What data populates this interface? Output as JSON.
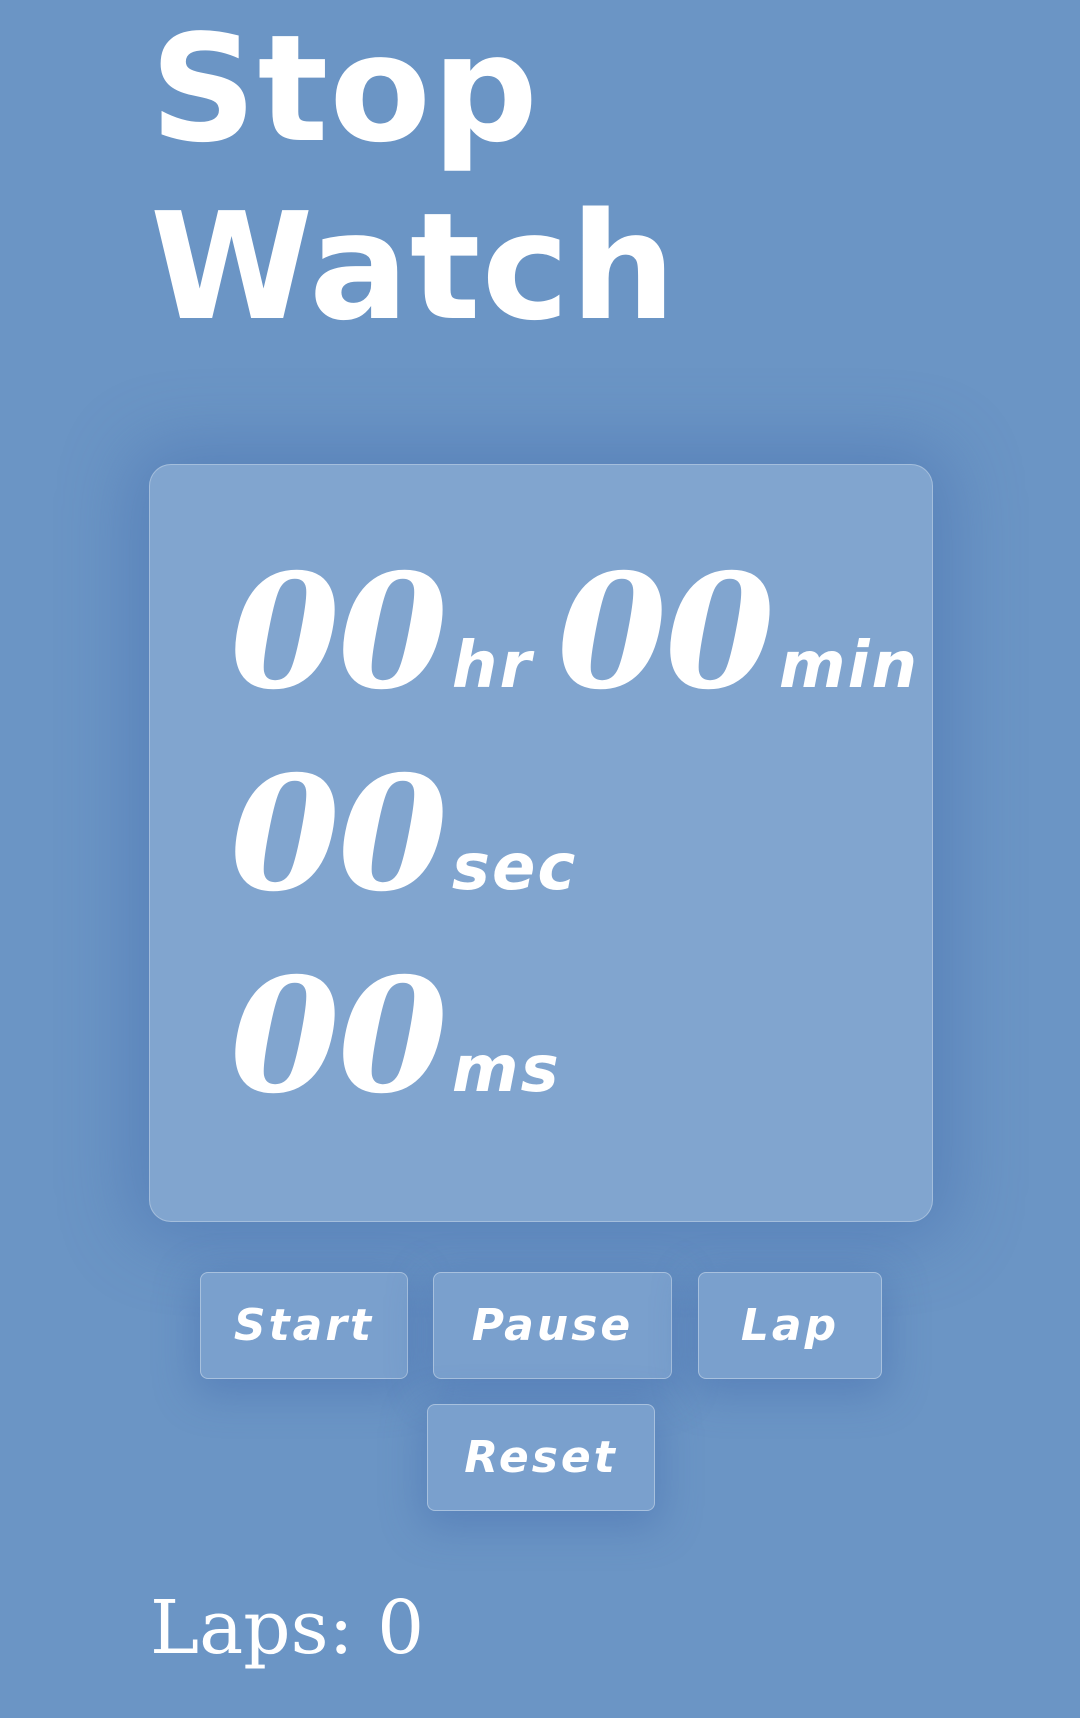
{
  "title": {
    "line1": "Stop",
    "line2": "Watch"
  },
  "clock": {
    "hours": "00",
    "hours_unit": "hr",
    "minutes": "00",
    "minutes_unit": "min",
    "seconds": "00",
    "seconds_unit": "sec",
    "milliseconds": "00",
    "milliseconds_unit": "ms"
  },
  "controls": {
    "start_label": "Start",
    "pause_label": "Pause",
    "lap_label": "Lap",
    "reset_label": "Reset"
  },
  "laps": {
    "label": "Laps:",
    "count": "0"
  },
  "colors": {
    "background": "#6b95c5",
    "card": "#81a5cf",
    "text": "#ffffff"
  }
}
